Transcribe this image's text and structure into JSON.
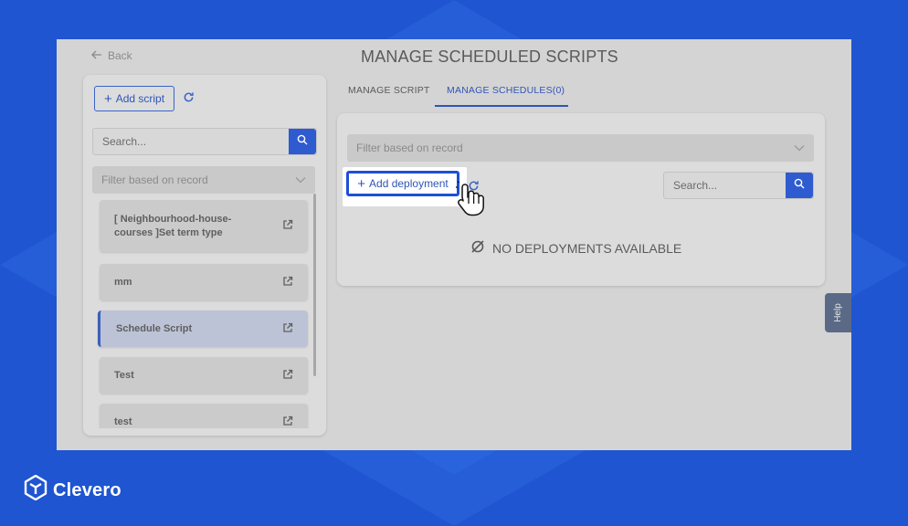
{
  "nav": {
    "back_label": "Back"
  },
  "page": {
    "title": "MANAGE SCHEDULED SCRIPTS"
  },
  "left_panel": {
    "add_script_label": "Add script",
    "search_placeholder": "Search...",
    "filter_placeholder": "Filter based on record",
    "items": [
      {
        "label": "[ Neighbourhood-house-courses ]Set term type",
        "active": false
      },
      {
        "label": "mm",
        "active": false
      },
      {
        "label": "Schedule Script",
        "active": true
      },
      {
        "label": "Test",
        "active": false
      },
      {
        "label": "test",
        "active": false
      }
    ]
  },
  "tabs": [
    {
      "label": "MANAGE SCRIPT",
      "active": false
    },
    {
      "label": "MANAGE SCHEDULES(0)",
      "active": true
    }
  ],
  "right_panel": {
    "filter_placeholder": "Filter based on record",
    "add_deployment_label": "Add deployment",
    "search_placeholder": "Search...",
    "empty_message": "NO DEPLOYMENTS AVAILABLE"
  },
  "help": {
    "label": "Help"
  },
  "brand": {
    "name": "Clevero"
  },
  "colors": {
    "accent": "#2f5bd0",
    "background": "#1f55d0",
    "highlight": "#1d4fd8"
  }
}
